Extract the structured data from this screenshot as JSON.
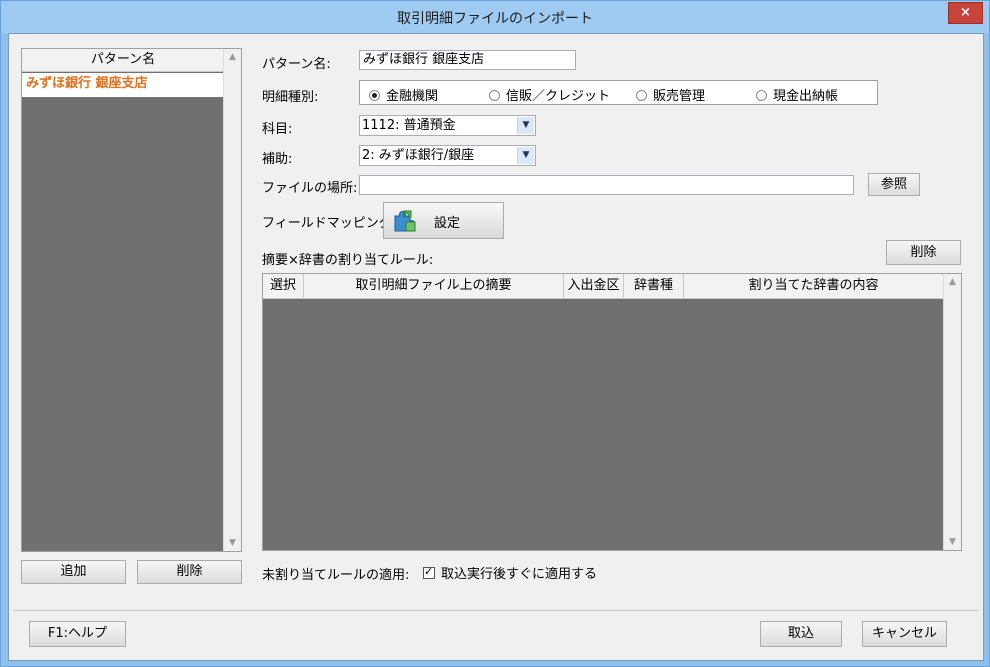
{
  "window": {
    "title": "取引明細ファイルのインポート",
    "close_label": "×"
  },
  "patterns": {
    "header": "パターン名",
    "items": [
      "みずほ銀行 銀座支店"
    ],
    "add_label": "追加",
    "delete_label": "削除"
  },
  "form": {
    "pattern_name_label": "パターン名:",
    "pattern_name_value": "みずほ銀行 銀座支店",
    "detail_type_label": "明細種別:",
    "detail_type_options": [
      "金融機関",
      "信販／クレジット",
      "販売管理",
      "現金出納帳"
    ],
    "detail_type_selected": "金融機関",
    "account_label": "科目:",
    "account_value": "1112: 普通預金",
    "sub_label": "補助:",
    "sub_value": "2: みずほ銀行/銀座",
    "file_location_label": "ファイルの場所:",
    "file_location_value": "",
    "browse_label": "参照",
    "field_mapping_label": "フィールドマッピング:",
    "field_mapping_button": "設定",
    "rules_label": "摘要×辞書の割り当てルール:",
    "rules_delete_label": "削除",
    "unassigned_label": "未割り当てルールの適用:",
    "apply_after_import_label": "取込実行後すぐに適用する",
    "apply_after_import_checked": true
  },
  "rules_table": {
    "columns": [
      "選択",
      "取引明細ファイル上の摘要",
      "入出金区",
      "辞書種",
      "割り当てた辞書の内容"
    ]
  },
  "footer": {
    "help_label": "F1:ヘルプ",
    "import_label": "取込",
    "cancel_label": "キャンセル"
  }
}
